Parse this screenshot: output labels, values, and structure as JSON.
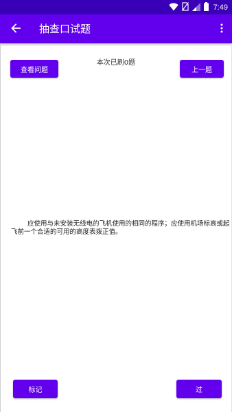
{
  "status_bar": {
    "time": "7:49",
    "icons": [
      "wifi-icon",
      "no-sim-icon",
      "signal-icon",
      "battery-icon"
    ]
  },
  "app_bar": {
    "title": "抽查口试题",
    "back_icon": "arrow-back-icon",
    "menu_icon": "more-vert-icon"
  },
  "progress": {
    "label": "本次已刷0题"
  },
  "buttons": {
    "view_question": "查看问题",
    "previous": "上一题",
    "mark": "标记",
    "pass": "过"
  },
  "question": {
    "text": "应使用与未安装无线电的飞机使用的相同的程序；应使用机场标高或起飞前一个合适的可用的高度表拨正值。"
  },
  "colors": {
    "primary": "#6200ee",
    "status_bar": "#3a00b8",
    "text": "#222222"
  }
}
